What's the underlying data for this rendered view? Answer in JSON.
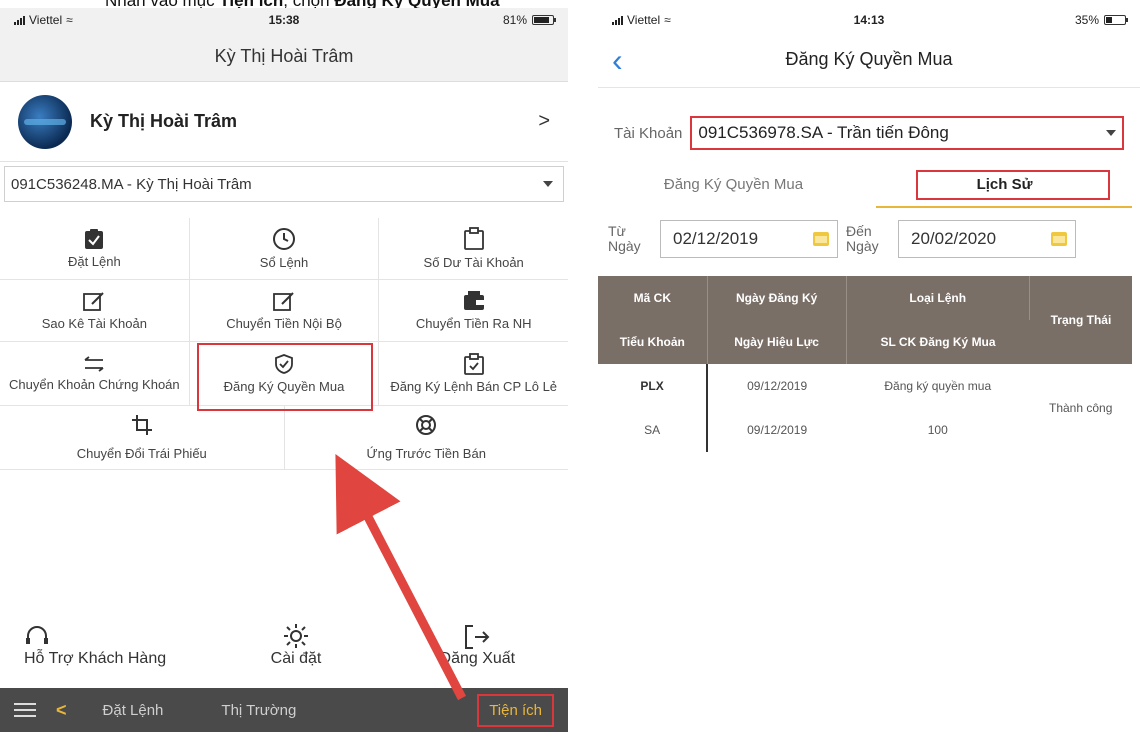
{
  "caption": {
    "prefix": "Nhấn vào mục ",
    "menu": "Tiện ích",
    "middle": ", chọn ",
    "item": "Đăng Ký Quyền Mua"
  },
  "left": {
    "status": {
      "carrier": "Viettel",
      "time": "15:38",
      "battery": "81%"
    },
    "title": "Kỳ Thị Hoài Trâm",
    "profile_name": "Kỳ Thị Hoài Trâm",
    "account": "091C536248.MA - Kỳ Thị Hoài Trâm",
    "menu": {
      "dat_lenh": "Đặt Lệnh",
      "so_lenh": "Sổ Lệnh",
      "so_du": "Số Dư Tài Khoản",
      "sao_ke": "Sao Kê Tài Khoản",
      "chuyen_noi_bo": "Chuyển Tiền Nội Bộ",
      "chuyen_ra_nh": "Chuyển Tiền Ra NH",
      "chuyen_ck": "Chuyển Khoản Chứng Khoán",
      "dang_ky_quyen_mua": "Đăng Ký Quyền Mua",
      "dang_ky_le": "Đăng Ký Lệnh Bán CP Lô Lẻ",
      "chuyen_doi_tp": "Chuyển Đổi Trái Phiếu",
      "ung_truoc": "Ứng Trước Tiền Bán"
    },
    "actions": {
      "support": "Hỗ Trợ Khách Hàng",
      "settings": "Cài đặt",
      "logout": "Đăng Xuất"
    },
    "tabbar": {
      "dat_lenh": "Đặt Lệnh",
      "thi_truong": "Thị Trường",
      "tien_ich": "Tiện ích"
    }
  },
  "right": {
    "status": {
      "carrier": "Viettel",
      "time": "14:13",
      "battery": "35%"
    },
    "title": "Đăng Ký Quyền Mua",
    "account_label": "Tài Khoản",
    "account": "091C536978.SA - Trần tiến Đông",
    "tabs": {
      "register": "Đăng Ký Quyền Mua",
      "history": "Lịch Sử"
    },
    "from_label": "Từ Ngày",
    "from_date": "02/12/2019",
    "to_label": "Đến Ngày",
    "to_date": "20/02/2020",
    "table": {
      "h_ma_ck": "Mã CK",
      "h_ngay_dk": "Ngày Đăng Ký",
      "h_loai": "Loại Lệnh",
      "h_trang_thai": "Trạng Thái",
      "h_tieu_khoan": "Tiểu Khoản",
      "h_ngay_hl": "Ngày Hiệu Lực",
      "h_sl": "SL CK Đăng Ký Mua",
      "r1_ma": "PLX",
      "r1_ngay": "09/12/2019",
      "r1_loai": "Đăng ký quyền mua",
      "r2_tk": "SA",
      "r2_ngay": "09/12/2019",
      "r2_sl": "100",
      "status_value": "Thành công"
    }
  }
}
